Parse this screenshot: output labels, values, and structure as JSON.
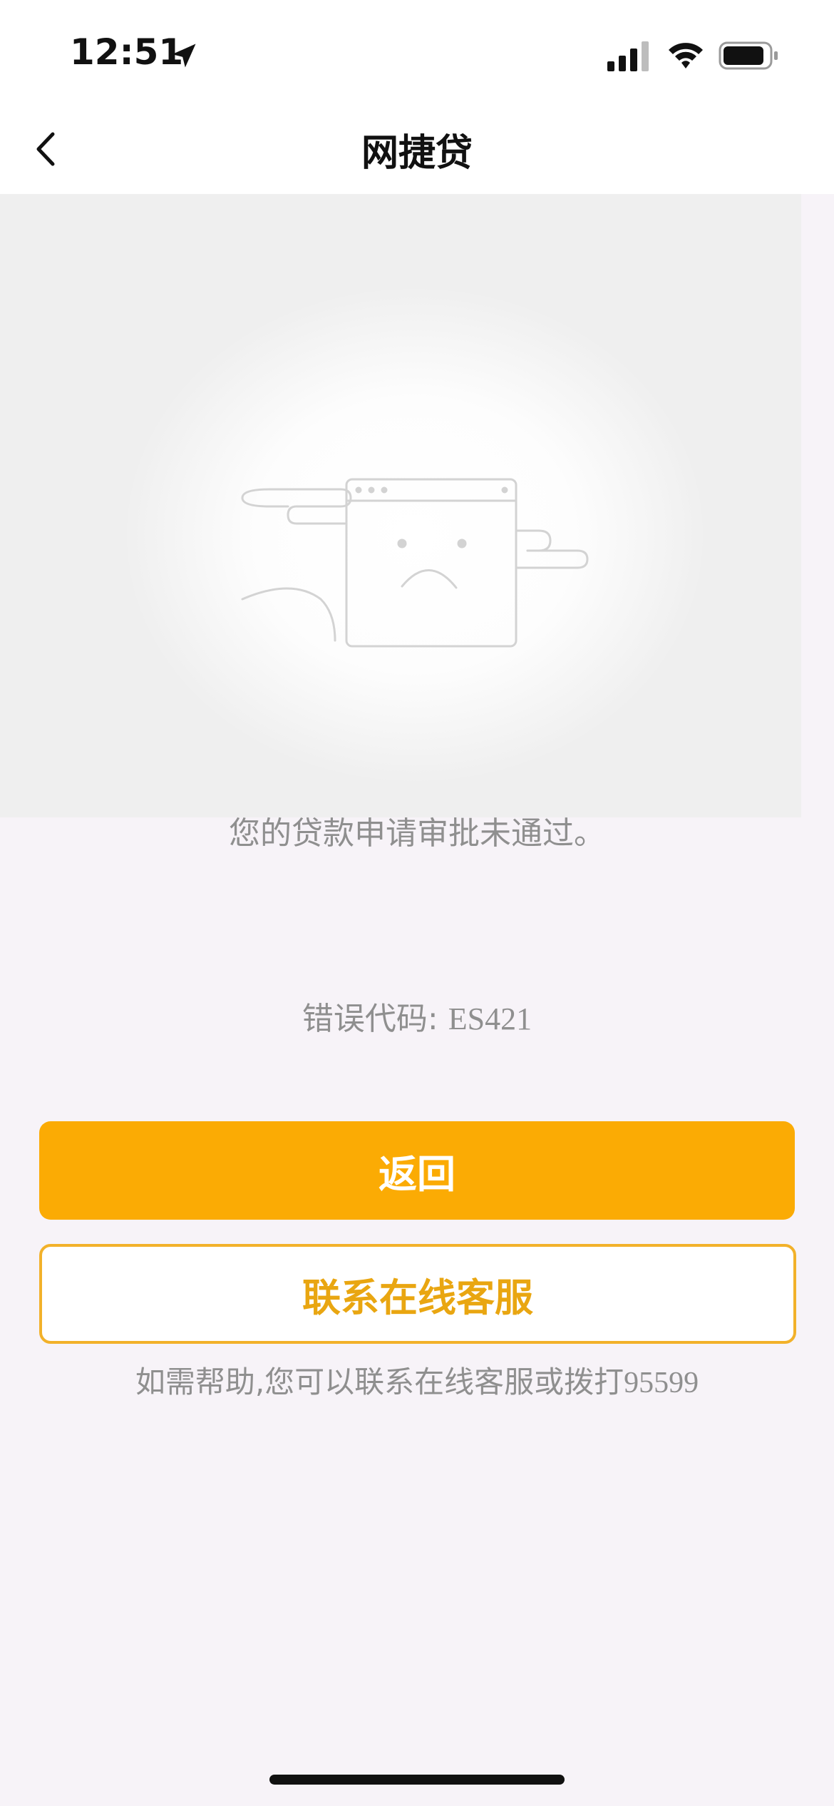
{
  "status_bar": {
    "time": "12:51",
    "icons": [
      "location-arrow-icon",
      "cellular-signal-icon",
      "wifi-icon",
      "battery-icon"
    ]
  },
  "nav": {
    "title": "网捷贷",
    "back_icon": "chevron-left-icon"
  },
  "result": {
    "illustration": "sad-window-illustration",
    "message": "您的贷款申请审批未通过。",
    "error_label": "错误代码: ",
    "error_code": "ES421"
  },
  "actions": {
    "back_label": "返回",
    "contact_label": "联系在线客服"
  },
  "help": {
    "text": "如需帮助,您可以联系在线客服或拨打",
    "phone": "95599"
  },
  "colors": {
    "primary": "#fbab04",
    "outline": "#f2b12a",
    "page_background": "#f7f3f8",
    "muted_text": "#8f8f8f"
  }
}
